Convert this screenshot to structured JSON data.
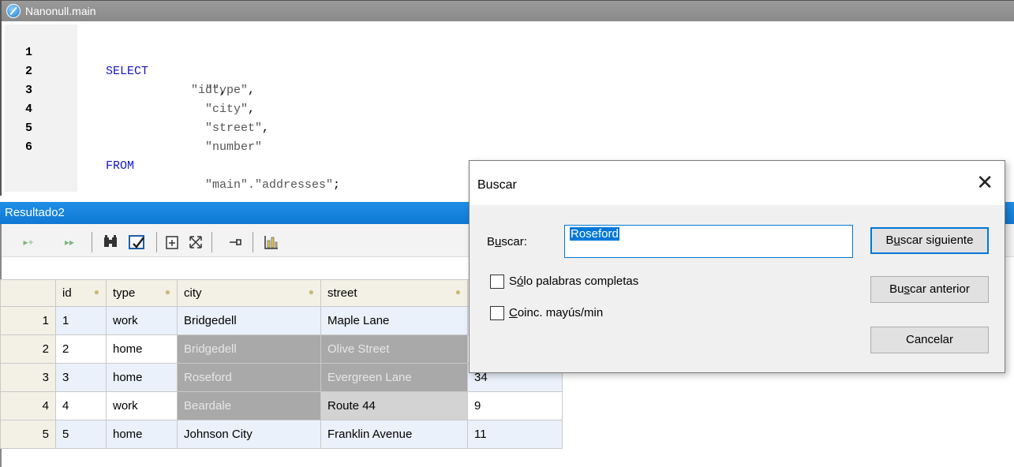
{
  "editor": {
    "title": "Nanonull.main",
    "lines": [
      {
        "num": "1",
        "kw": "SELECT",
        "str": "\"id\"",
        "punc": ","
      },
      {
        "num": "2",
        "kw": "",
        "str": "\"type\"",
        "punc": ","
      },
      {
        "num": "3",
        "kw": "",
        "str": "\"city\"",
        "punc": ","
      },
      {
        "num": "4",
        "kw": "",
        "str": "\"street\"",
        "punc": ","
      },
      {
        "num": "5",
        "kw": "",
        "str": "\"number\"",
        "punc": ""
      },
      {
        "num": "6",
        "kw": "FROM",
        "str": "\"main\".\"addresses\"",
        "punc": ";"
      }
    ]
  },
  "result": {
    "tab_label": "Resultado2",
    "toolbar_icons": [
      "insert-row-icon",
      "fast-forward-icon",
      "find-icon",
      "clear-filter-icon",
      "copy-icon",
      "expand-icon",
      "pin-icon",
      "chart-icon"
    ],
    "columns": [
      "id",
      "type",
      "city",
      "street"
    ],
    "rows": [
      {
        "row": "1",
        "id": "1",
        "type": "work",
        "city": "Bridgedell",
        "street": "Maple Lane",
        "number": ""
      },
      {
        "row": "2",
        "id": "2",
        "type": "home",
        "city": "Bridgedell",
        "street": "Olive Street",
        "number": ""
      },
      {
        "row": "3",
        "id": "3",
        "type": "home",
        "city": "Roseford",
        "street": "Evergreen Lane",
        "number": "34"
      },
      {
        "row": "4",
        "id": "4",
        "type": "work",
        "city": "Beardale",
        "street": "Route 44",
        "number": "9"
      },
      {
        "row": "5",
        "id": "5",
        "type": "home",
        "city": "Johnson City",
        "street": "Franklin Avenue",
        "number": "11"
      }
    ]
  },
  "dialog": {
    "title": "Buscar",
    "search_label_pre": "B",
    "search_label_ul": "u",
    "search_label_post": "scar:",
    "search_value": "Roseford",
    "whole_words_pre": "S",
    "whole_words_ul": "ó",
    "whole_words_post": "lo palabras completas",
    "match_case_pre": "",
    "match_case_ul": "C",
    "match_case_post": "oinc. mayús/min",
    "find_next_pre": "B",
    "find_next_ul": "u",
    "find_next_post": "scar siguiente",
    "find_prev_pre": "Bu",
    "find_prev_ul": "s",
    "find_prev_post": "car anterior",
    "cancel_label": "Cancelar"
  }
}
